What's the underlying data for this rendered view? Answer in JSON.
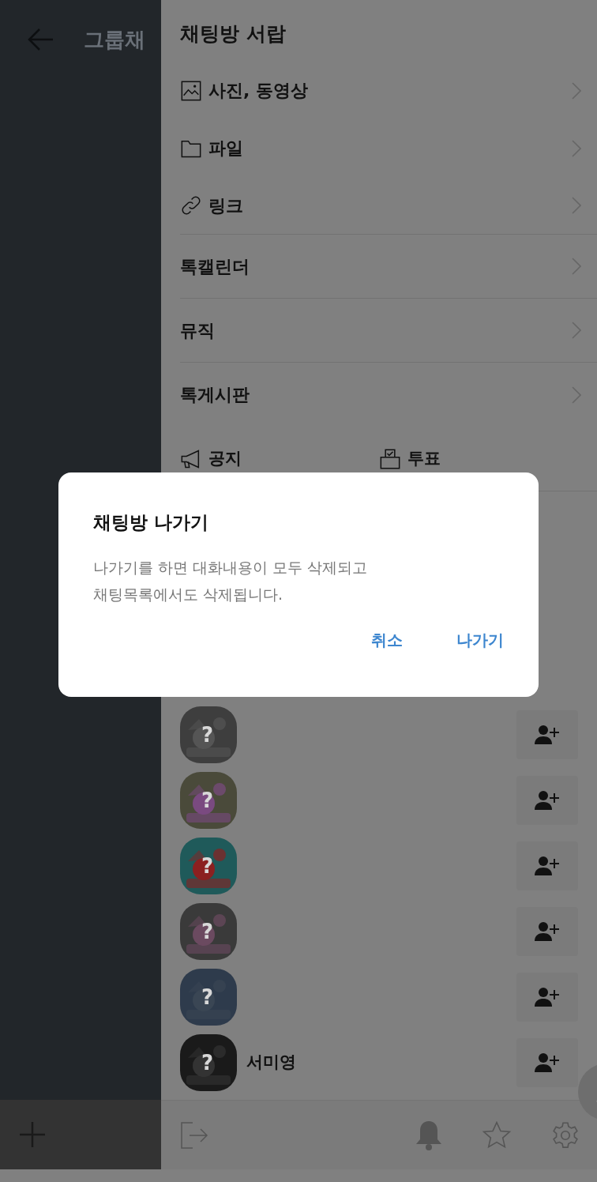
{
  "chat_header": {
    "title": "그룹채"
  },
  "drawer": {
    "title": "채팅방 서랍",
    "items": [
      {
        "label": "사진, 동영상",
        "divider": false
      },
      {
        "kind": "folder",
        "label": "파일",
        "divider": false
      },
      {
        "kind": "link",
        "label": "링크",
        "divider": true
      },
      {
        "kind": "plain",
        "label": "톡캘린더",
        "divider": true
      },
      {
        "kind": "plain",
        "label": "뮤직",
        "divider": true
      },
      {
        "kind": "plain",
        "label": "톡게시판",
        "divider": false
      }
    ],
    "shortcuts": [
      {
        "kind": "notice",
        "label": "공지"
      },
      {
        "kind": "vote",
        "label": "투표"
      }
    ],
    "members": [
      {
        "mark": "?"
      },
      {
        "mark": "?"
      },
      {
        "mark": "?"
      },
      {
        "mark": "?"
      },
      {
        "mark": "?"
      },
      {
        "mark": "?",
        "name": "서미영"
      }
    ]
  },
  "dialog": {
    "title": "채팅방 나가기",
    "message": "나가기를 하면 대화내용이 모두 삭제되고\n채팅목록에서도 삭제됩니다.",
    "buttons": [
      "취소",
      "나가기"
    ]
  }
}
